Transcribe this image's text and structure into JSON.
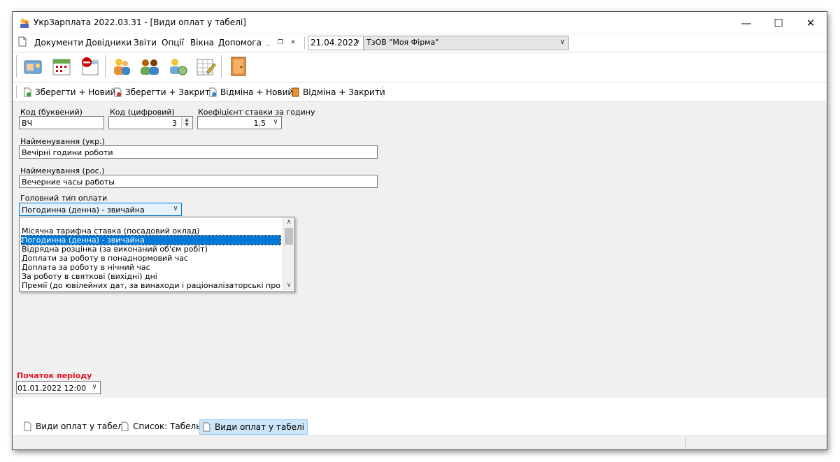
{
  "window": {
    "title": "УкрЗарплата 2022.03.31 - [Види оплат у табелі]",
    "controls": {
      "minimize": "—",
      "maximize": "☐",
      "close": "✕"
    }
  },
  "menu": {
    "items": [
      "Документи",
      "Довідники",
      "Звіти",
      "Опції",
      "Вікна",
      "Допомога"
    ],
    "date_value": "21.04.2022",
    "firm_value": "ТзОВ \"Моя Фірма\""
  },
  "actions": [
    "Зберегти + Новий",
    "Зберегти + Закрити",
    "Відміна + Новий",
    "Відміна + Закрити"
  ],
  "form": {
    "code_letter_label": "Код (буквений)",
    "code_letter_value": "ВЧ",
    "code_digit_label": "Код (цифровий)",
    "code_digit_value": "3",
    "rate_label": "Коефіцієнт ставки за годину",
    "rate_value": "1,5",
    "name_ukr_label": "Найменування (укр.)",
    "name_ukr_value": "Вечірні години роботи",
    "name_rus_label": "Найменування (рос.)",
    "name_rus_value": "Вечерние часы работы",
    "main_type_label": "Головний тип оплати",
    "main_type_value": "Погодинна (денна) - звичайна",
    "dropdown_options": [
      "Місячна тарифна ставка (посадовий оклад)",
      "Погодинна (денна) - звичайна",
      "Відрядна розцінка (за виконаний об'єм робіт)",
      "Доплати за роботу в понаднормовий час",
      "Доплата за роботу в нічний час",
      "За роботу в святкові (вихідні) дні",
      "Премії (до ювілейних дат, за винаходи і раціоналізаторські пропозиції...)"
    ],
    "selected_option_index": 1,
    "period_label": "Початок періоду",
    "period_value": "01.01.2022 12:00"
  },
  "tabs": [
    {
      "label": "Види оплат у табелі",
      "active": false
    },
    {
      "label": "Список: Табель",
      "active": false
    },
    {
      "label": "Види оплат у табелі",
      "active": true
    }
  ],
  "colors": {
    "accent": "#0078d7",
    "period_label": "#e81123",
    "selected_tab": "#cce4f7"
  }
}
